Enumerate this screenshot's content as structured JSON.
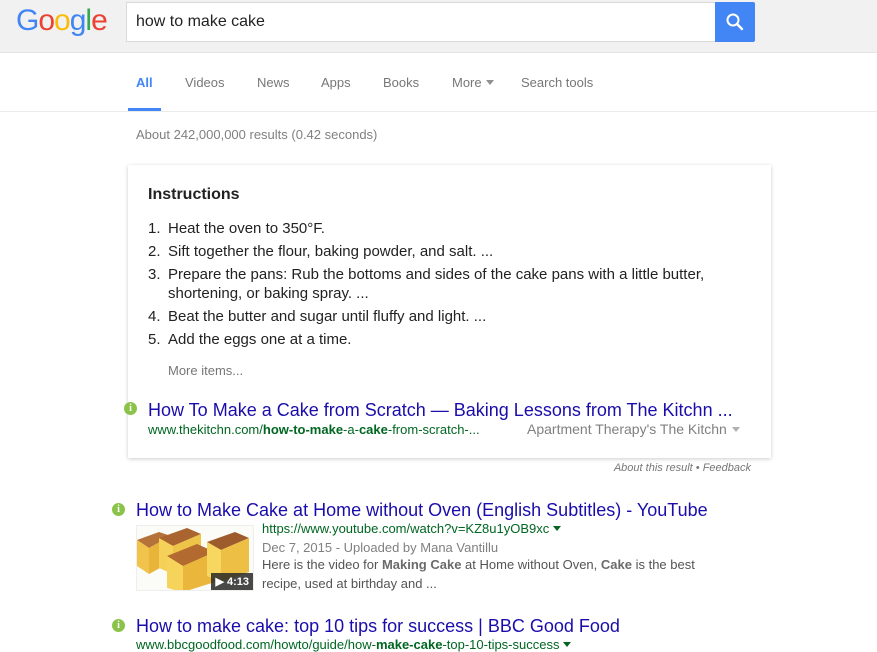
{
  "header": {
    "logo": [
      "G",
      "o",
      "o",
      "g",
      "l",
      "e"
    ],
    "logo_colors": [
      "#4285f4",
      "#ea4335",
      "#fbbc05",
      "#4285f4",
      "#34a853",
      "#ea4335"
    ],
    "search_query": "how to make cake",
    "search_button_icon": "search-icon",
    "accent_color": "#4285f4"
  },
  "tabs": [
    {
      "label": "All",
      "active": true
    },
    {
      "label": "Videos"
    },
    {
      "label": "News"
    },
    {
      "label": "Apps"
    },
    {
      "label": "Books"
    },
    {
      "label": "More"
    },
    {
      "label": "Search tools"
    }
  ],
  "stats": "About 242,000,000 results (0.42 seconds)",
  "featured": {
    "title": "Instructions",
    "steps": [
      {
        "num": "1.",
        "text": "Heat the oven to 350°F."
      },
      {
        "num": "2.",
        "text": "Sift together the flour, baking powder, and salt. ..."
      },
      {
        "num": "3.",
        "text": "Prepare the pans: Rub the bottoms and sides of the cake pans with a little butter, shortening, or baking spray. ..."
      },
      {
        "num": "4.",
        "text": "Beat the butter and sugar until fluffy and light. ..."
      },
      {
        "num": "5.",
        "text": "Add the eggs one at a time."
      }
    ],
    "more_items": "More items...",
    "result_title": "How To Make a Cake from Scratch — Baking Lessons from The Kitchn ...",
    "url_parts": [
      "www.thekitchn.com/",
      "how-to-make",
      "-a-",
      "cake",
      "-from-scratch-..."
    ],
    "source": "Apartment Therapy's The Kitchn",
    "about_result": "About this result",
    "separator": " • ",
    "feedback": "Feedback"
  },
  "results": [
    {
      "title": "How to Make Cake at Home without Oven (English Subtitles) - YouTube",
      "url": "https://www.youtube.com/watch?v=KZ8u1yOB9xc",
      "meta": "Dec 7, 2015 - Uploaded by Mana Vantillu",
      "snippet_parts": [
        "Here is the video for ",
        "Making Cake",
        " at Home without Oven, ",
        "Cake",
        " is the best"
      ],
      "snippet_line2": "recipe, used at birthday and ...",
      "duration": "4:13",
      "play_icon": "play-icon"
    },
    {
      "title": "How to make cake: top 10 tips for success | BBC Good Food",
      "url_parts": [
        "www.bbcgoodfood.com/howto/guide/how-",
        "make-cake",
        "-top-10-tips-success"
      ]
    }
  ]
}
